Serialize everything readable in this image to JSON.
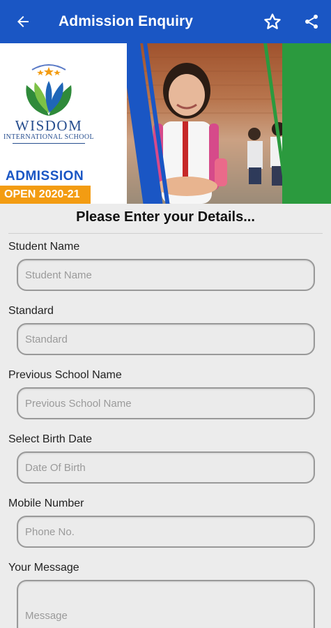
{
  "appbar": {
    "title": "Admission Enquiry",
    "back_icon": "arrow-left-icon",
    "favorite_icon": "star-icon",
    "share_icon": "share-icon",
    "color": "#1a56c4"
  },
  "banner": {
    "school_name_line1": "WISDOM",
    "school_name_line2": "INTERNATIONAL SCHOOL",
    "admission_label": "ADMISSION",
    "open_label": "OPEN 2020-21"
  },
  "form": {
    "heading": "Please Enter your Details...",
    "fields": [
      {
        "label": "Student Name",
        "placeholder": "Student Name"
      },
      {
        "label": "Standard",
        "placeholder": "Standard"
      },
      {
        "label": "Previous School Name",
        "placeholder": "Previous School Name"
      },
      {
        "label": "Select Birth Date",
        "placeholder": "Date Of Birth"
      },
      {
        "label": "Mobile Number",
        "placeholder": "Phone No."
      },
      {
        "label": "Your Message",
        "placeholder": "Message"
      }
    ]
  }
}
